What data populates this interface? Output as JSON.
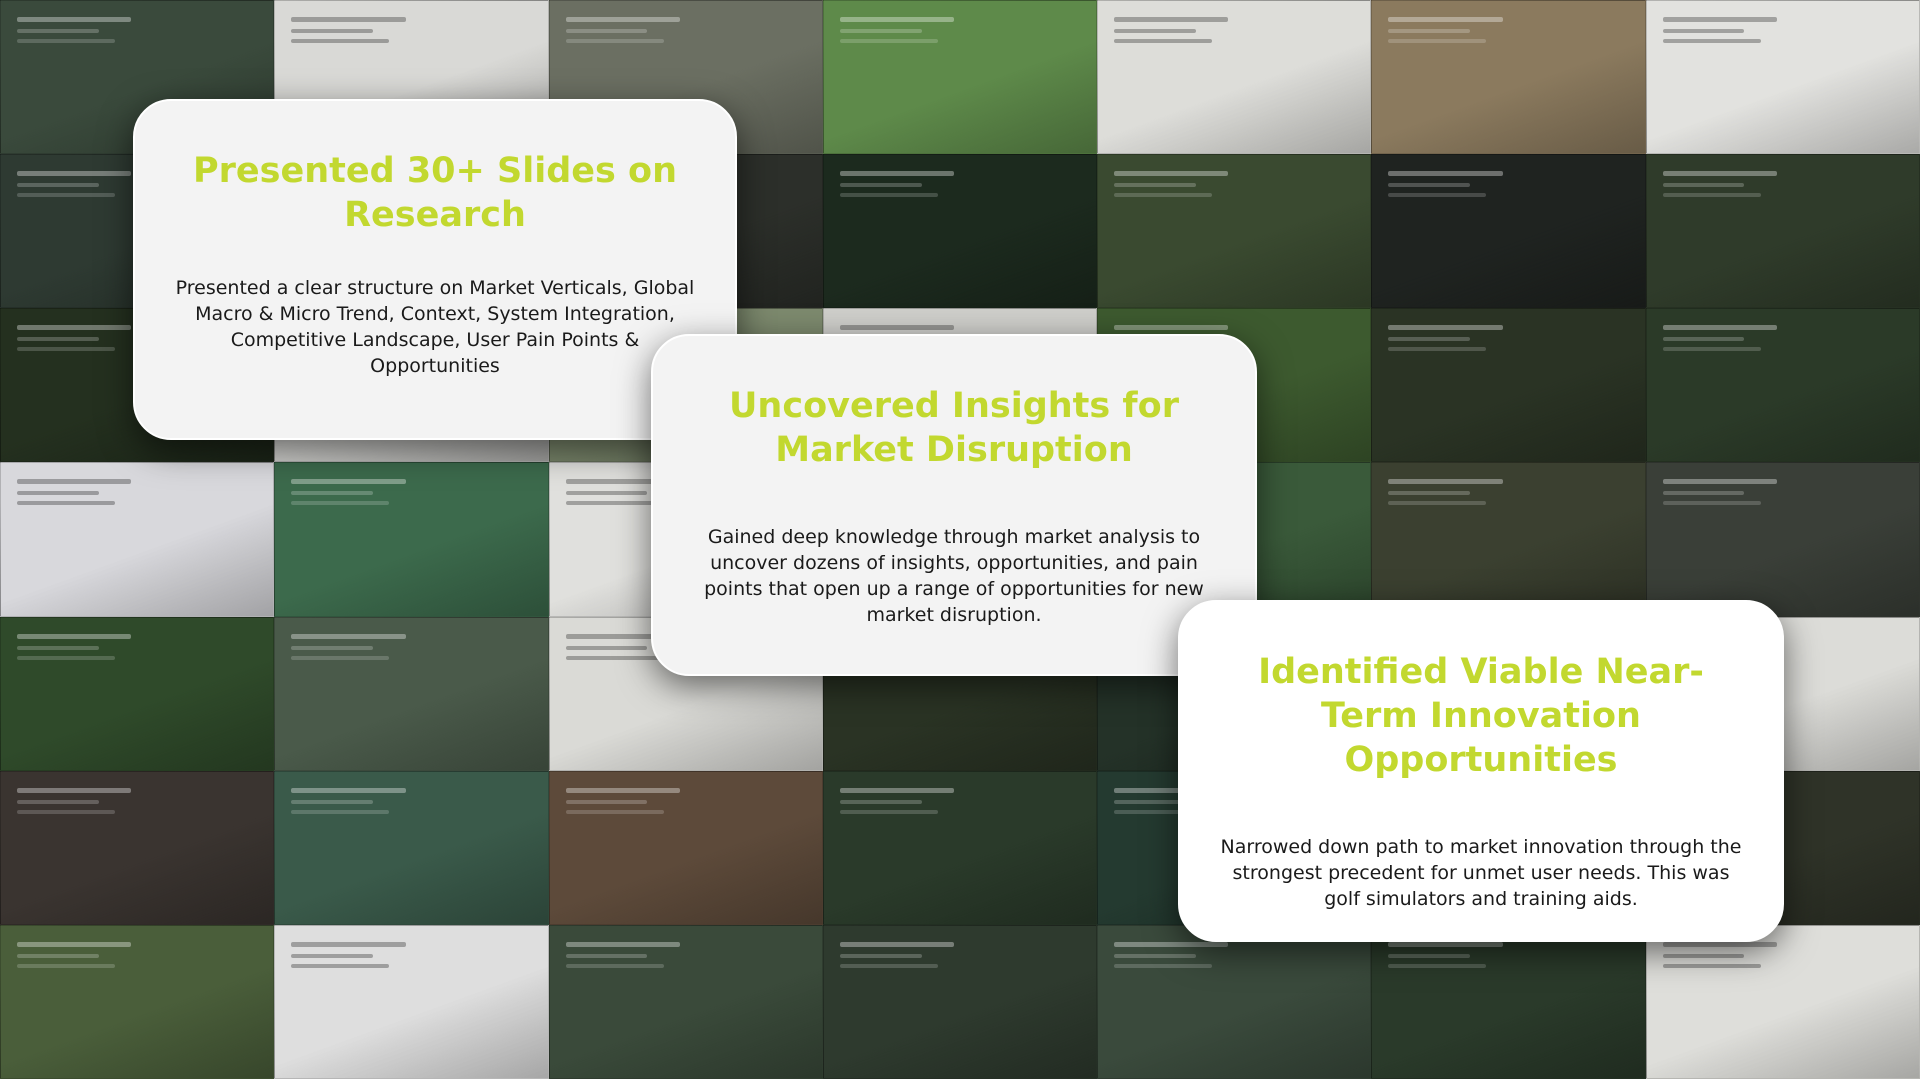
{
  "cards": [
    {
      "title": "Presented 30+ Slides on Research",
      "body": "Presented a clear structure on Market Verticals, Global Macro & Micro Trend, Context, System Integration, Competitive Landscape, User Pain Points & Opportunities"
    },
    {
      "title": "Uncovered Insights for Market Disruption",
      "body": "Gained deep knowledge through market analysis to uncover dozens of insights, opportunities, and pain points that open up a range of opportunities for new market disruption."
    },
    {
      "title": "Identified Viable Near-Term Innovation Opportunities",
      "body": "Narrowed down path to market innovation through the strongest precedent for unmet user needs. This was golf simulators and training aids."
    }
  ],
  "colors": {
    "accent": "#c2d82f",
    "card_bg": "#f3f3f3",
    "text": "#1a1a1a"
  },
  "mosaic_tiles": [
    "#3a4a3c",
    "#d9d9d6",
    "#6b6f62",
    "#5e8a4a",
    "#ddddd9",
    "#8b7a5e",
    "#e2e2df",
    "#2e3a32",
    "#3c4a2e",
    "#2c2f2a",
    "#1c2a1e",
    "#3a4a30",
    "#1f2320",
    "#2f3b2a",
    "#24301f",
    "#d6d6d3",
    "#7d8a6e",
    "#cfcfcb",
    "#3d5a2f",
    "#2a3324",
    "#2b3a28",
    "#d8d8dc",
    "#3c6a4c",
    "#e0e0dd",
    "#5d7d5a",
    "#3a5a3a",
    "#3b4030",
    "#3a3f38",
    "#2f4a2a",
    "#4a5a4a",
    "#dadad6",
    "#2a3324",
    "#243228",
    "#3a4a2e",
    "#dcdcd8",
    "#3a3430",
    "#3a5a4a",
    "#5d4a3a",
    "#2a3a2a",
    "#243a30",
    "#2a3a2e",
    "#2f3328",
    "#4a5e3a",
    "#dedede",
    "#3a4a3a",
    "#2e3a2e",
    "#3a4a3c",
    "#2a3a2a",
    "#dedeDA"
  ]
}
